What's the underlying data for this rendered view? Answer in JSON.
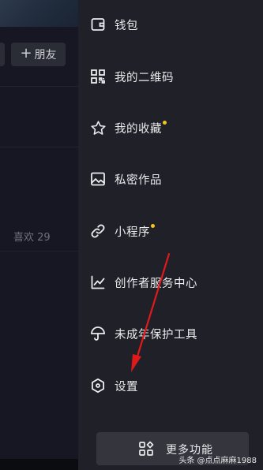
{
  "profile": {
    "add_friend_label": "朋友",
    "likes_label": "喜欢 29"
  },
  "drawer": {
    "items": [
      {
        "label": "钱包",
        "icon": "wallet-icon"
      },
      {
        "label": "我的二维码",
        "icon": "qr-code-icon"
      },
      {
        "label": "我的收藏",
        "icon": "star-icon",
        "dot": true
      },
      {
        "label": "私密作品",
        "icon": "image-icon"
      },
      {
        "label": "小程序",
        "icon": "link-icon",
        "dot": true
      },
      {
        "label": "创作者服务中心",
        "icon": "chart-icon"
      },
      {
        "label": "未成年保护工具",
        "icon": "umbrella-icon"
      },
      {
        "label": "设置",
        "icon": "settings-icon"
      }
    ],
    "more_label": "更多功能"
  },
  "watermark": {
    "prefix": "头条",
    "handle": "@点点麻麻1988"
  },
  "colors": {
    "background": "#161823",
    "drawer": "#1f2028",
    "dot": "#f5c518",
    "arrow": "#e0191b"
  }
}
